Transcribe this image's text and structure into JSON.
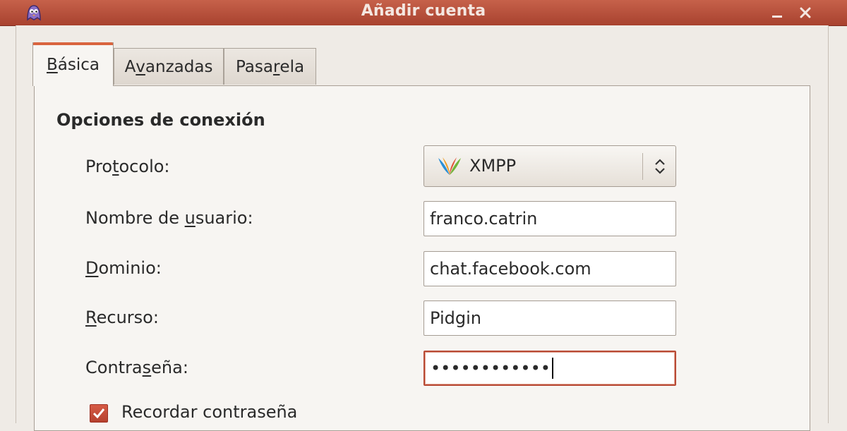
{
  "window": {
    "title": "Añadir cuenta"
  },
  "tabs": [
    {
      "label_pre": "",
      "label_key": "B",
      "label_post": "ásica",
      "active": true
    },
    {
      "label_pre": "A",
      "label_key": "v",
      "label_post": "anzadas",
      "active": false
    },
    {
      "label_pre": "Pasa",
      "label_key": "r",
      "label_post": "ela",
      "active": false
    }
  ],
  "section": {
    "title": "Opciones de conexión"
  },
  "form": {
    "protocol": {
      "label_pre": "Pro",
      "label_key": "t",
      "label_post": "ocolo:",
      "value": "XMPP"
    },
    "username": {
      "label_pre": "Nombre de ",
      "label_key": "u",
      "label_post": "suario:",
      "value": "franco.catrin"
    },
    "domain": {
      "label_pre": "",
      "label_key": "D",
      "label_post": "ominio:",
      "value": "chat.facebook.com"
    },
    "resource": {
      "label_pre": "",
      "label_key": "R",
      "label_post": "ecurso:",
      "value": "Pidgin"
    },
    "password": {
      "label_pre": "Contra",
      "label_key": "s",
      "label_post": "eña:",
      "value": "••••••••••••"
    },
    "remember": {
      "label": "Recordar contraseña",
      "checked": true
    }
  },
  "icons": {
    "app": "pidgin-icon",
    "protocol": "xmpp-icon",
    "minimize": "minimize-icon",
    "close": "close-icon",
    "combo_arrows": "up-down-arrows-icon",
    "checkbox": "check-icon"
  },
  "colors": {
    "titlebar": "#b5513c",
    "accent": "#d9643f",
    "focus_border": "#b84a35"
  }
}
